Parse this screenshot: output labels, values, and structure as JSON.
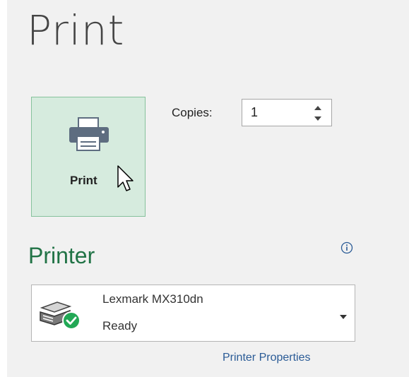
{
  "header": {
    "title": "Print"
  },
  "print_button": {
    "label": "Print",
    "icon": "printer-icon"
  },
  "copies": {
    "label": "Copies:",
    "value": "1"
  },
  "printer_section": {
    "title": "Printer",
    "info_icon": "info-icon",
    "selected_printer": {
      "name": "Lexmark MX310dn",
      "status": "Ready",
      "icon": "printer-ready-icon"
    },
    "properties_link": "Printer Properties"
  },
  "colors": {
    "accent_green": "#217346",
    "button_bg": "#d6ebde",
    "link_blue": "#2a5b96"
  }
}
